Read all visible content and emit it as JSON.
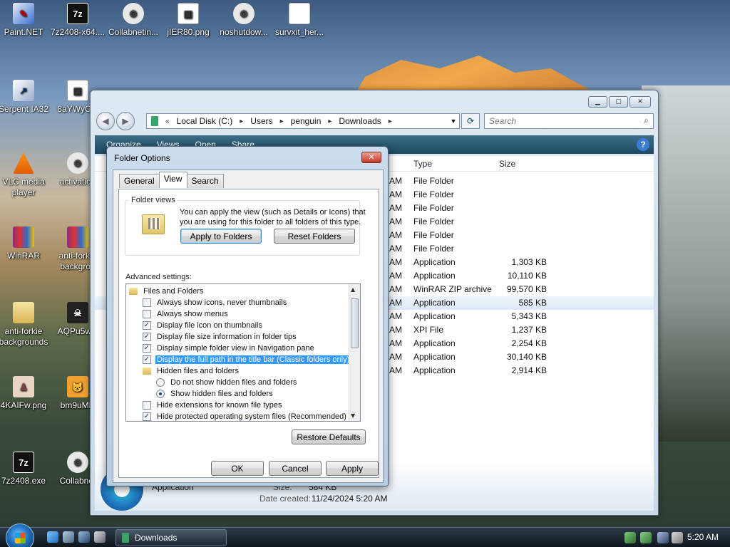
{
  "desktop": {
    "icons": [
      {
        "label": "Paint.NET",
        "glyph": "✎",
        "kind": "paint"
      },
      {
        "label": "7z2408-x64....",
        "glyph": "7z",
        "kind": "sevenz"
      },
      {
        "label": "Collabnetin...",
        "glyph": "⚙",
        "kind": "gear"
      },
      {
        "label": "jIER80.png",
        "glyph": "▣",
        "kind": "png"
      },
      {
        "label": "noshutdow...",
        "glyph": "⚙",
        "kind": "gear"
      },
      {
        "label": "survxit_her...",
        "glyph": "",
        "kind": "file"
      },
      {
        "label": "Serpent IA32",
        "glyph": "↗",
        "kind": "shortcut"
      },
      {
        "label": "8aYWyC.p",
        "glyph": "▣",
        "kind": "png"
      },
      {
        "label": "VLC media player",
        "glyph": "",
        "kind": "vlc"
      },
      {
        "label": "activation",
        "glyph": "⚙",
        "kind": "gear"
      },
      {
        "label": "WinRAR",
        "glyph": "",
        "kind": "rar"
      },
      {
        "label": "anti-forkie backgrou",
        "glyph": "",
        "kind": "rar"
      },
      {
        "label": "anti-forkie backgrounds",
        "glyph": "",
        "kind": "folder"
      },
      {
        "label": "AQPu5w.p",
        "glyph": "☠",
        "kind": "dark"
      },
      {
        "label": "4KAIFw.png",
        "glyph": "♟",
        "kind": "pic"
      },
      {
        "label": "bm9uMH",
        "glyph": "🐱",
        "kind": "cat"
      },
      {
        "label": "7z2408.exe",
        "glyph": "7z",
        "kind": "sevenz"
      },
      {
        "label": "Collabnet",
        "glyph": "⚙",
        "kind": "gear"
      }
    ]
  },
  "explorer": {
    "address": {
      "prefix": "«",
      "crumbs": [
        "Local Disk (C:)",
        "Users",
        "penguin",
        "Downloads"
      ]
    },
    "search_placeholder": "Search",
    "toolbar": {
      "organize": "Organize",
      "views": "Views",
      "open": "Open",
      "share": "Share",
      "help": "?"
    },
    "columns": {
      "type": "Type",
      "size": "Size"
    },
    "rows": [
      {
        "am": "AM",
        "type": "File Folder",
        "size": ""
      },
      {
        "am": "AM",
        "type": "File Folder",
        "size": ""
      },
      {
        "am": "AM",
        "type": "File Folder",
        "size": ""
      },
      {
        "am": "AM",
        "type": "File Folder",
        "size": ""
      },
      {
        "am": "AM",
        "type": "File Folder",
        "size": ""
      },
      {
        "am": "AM",
        "type": "File Folder",
        "size": ""
      },
      {
        "am": "AM",
        "type": "Application",
        "size": "1,303 KB"
      },
      {
        "am": "AM",
        "type": "Application",
        "size": "10,110 KB"
      },
      {
        "am": "AM",
        "type": "WinRAR ZIP archive",
        "size": "99,570 KB"
      },
      {
        "am": "AM",
        "type": "Application",
        "size": "585 KB"
      },
      {
        "am": "AM",
        "type": "Application",
        "size": "5,343 KB"
      },
      {
        "am": "AM",
        "type": "XPI File",
        "size": "1,237 KB"
      },
      {
        "am": "AM",
        "type": "Application",
        "size": "2,254 KB"
      },
      {
        "am": "AM",
        "type": "Application",
        "size": "30,140 KB"
      },
      {
        "am": "AM",
        "type": "Application",
        "size": "2,914 KB"
      }
    ],
    "details": {
      "type_value": "Application",
      "size_label": "Size:",
      "size_value": "584 KB",
      "created_label": "Date created:",
      "created_value": "11/24/2024 5:20 AM"
    }
  },
  "dialog": {
    "title": "Folder Options",
    "tabs": [
      "General",
      "View",
      "Search"
    ],
    "active_tab": "View",
    "folder_views_title": "Folder views",
    "folder_views_text": "You can apply the view (such as Details or Icons) that you are using for this folder to all folders of this type.",
    "apply_to_folders": "Apply to Folders",
    "reset_folders": "Reset Folders",
    "advanced_label": "Advanced settings:",
    "tree": [
      {
        "kind": "folder",
        "indent": 0,
        "label": "Files and Folders"
      },
      {
        "kind": "check",
        "indent": 1,
        "checked": false,
        "label": "Always show icons, never thumbnails"
      },
      {
        "kind": "check",
        "indent": 1,
        "checked": false,
        "label": "Always show menus"
      },
      {
        "kind": "check",
        "indent": 1,
        "checked": true,
        "label": "Display file icon on thumbnails"
      },
      {
        "kind": "check",
        "indent": 1,
        "checked": true,
        "label": "Display file size information in folder tips"
      },
      {
        "kind": "check",
        "indent": 1,
        "checked": true,
        "label": "Display simple folder view in Navigation pane"
      },
      {
        "kind": "check",
        "indent": 1,
        "checked": true,
        "label": "Display the full path in the title bar (Classic folders only)",
        "selected": true
      },
      {
        "kind": "folder",
        "indent": 1,
        "label": "Hidden files and folders"
      },
      {
        "kind": "radio",
        "indent": 2,
        "checked": false,
        "label": "Do not show hidden files and folders"
      },
      {
        "kind": "radio",
        "indent": 2,
        "checked": true,
        "label": "Show hidden files and folders"
      },
      {
        "kind": "check",
        "indent": 1,
        "checked": false,
        "label": "Hide extensions for known file types"
      },
      {
        "kind": "check",
        "indent": 1,
        "checked": true,
        "label": "Hide protected operating system files (Recommended)"
      }
    ],
    "restore_defaults": "Restore Defaults",
    "ok": "OK",
    "cancel": "Cancel",
    "apply": "Apply"
  },
  "taskbar": {
    "task_label": "Downloads",
    "clock": "5:20 AM"
  },
  "colors": {
    "selection": "#3399ff",
    "toolbar": "#1c4a60"
  }
}
